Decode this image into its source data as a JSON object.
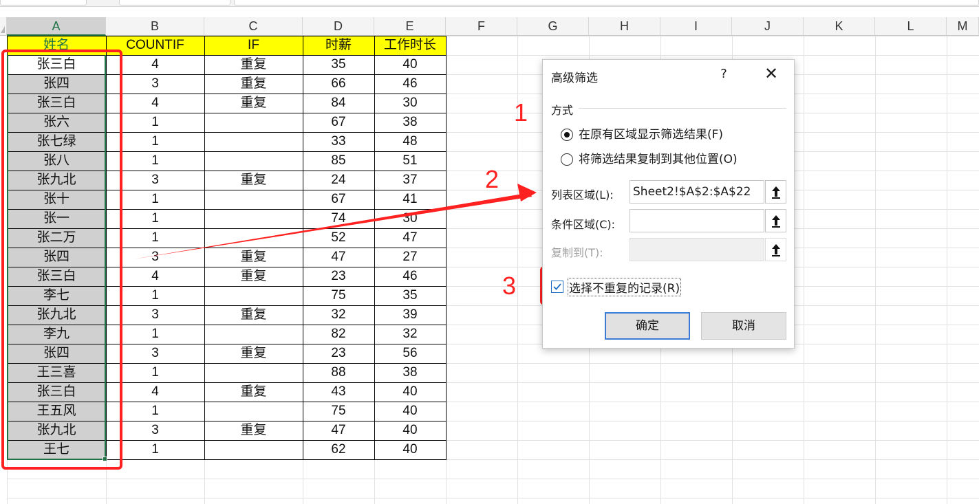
{
  "columns": [
    "A",
    "B",
    "C",
    "D",
    "E",
    "F",
    "G",
    "H",
    "I",
    "J",
    "K",
    "L",
    "M"
  ],
  "header_row": [
    "姓名",
    "COUNTIF",
    "IF",
    "时薪",
    "工作时长"
  ],
  "rows": [
    [
      "张三白",
      "4",
      "重复",
      "35",
      "40"
    ],
    [
      "张四",
      "3",
      "重复",
      "66",
      "46"
    ],
    [
      "张三白",
      "4",
      "重复",
      "84",
      "30"
    ],
    [
      "张六",
      "1",
      "",
      "67",
      "38"
    ],
    [
      "张七绿",
      "1",
      "",
      "33",
      "48"
    ],
    [
      "张八",
      "1",
      "",
      "85",
      "51"
    ],
    [
      "张九北",
      "3",
      "重复",
      "24",
      "37"
    ],
    [
      "张十",
      "1",
      "",
      "67",
      "41"
    ],
    [
      "张一",
      "1",
      "",
      "74",
      "30"
    ],
    [
      "张二万",
      "1",
      "",
      "52",
      "47"
    ],
    [
      "张四",
      "3",
      "重复",
      "47",
      "27"
    ],
    [
      "张三白",
      "4",
      "重复",
      "23",
      "46"
    ],
    [
      "李七",
      "1",
      "",
      "75",
      "35"
    ],
    [
      "张九北",
      "3",
      "重复",
      "32",
      "39"
    ],
    [
      "李九",
      "1",
      "",
      "82",
      "32"
    ],
    [
      "张四",
      "3",
      "重复",
      "23",
      "56"
    ],
    [
      "王三喜",
      "1",
      "",
      "88",
      "38"
    ],
    [
      "张三白",
      "4",
      "重复",
      "43",
      "40"
    ],
    [
      "王五风",
      "1",
      "",
      "75",
      "40"
    ],
    [
      "张九北",
      "3",
      "重复",
      "47",
      "40"
    ],
    [
      "王七",
      "1",
      "",
      "62",
      "40"
    ]
  ],
  "annotations": {
    "n1": "1",
    "n2": "2",
    "n3": "3"
  },
  "dialog": {
    "title": "高级筛选",
    "help": "?",
    "close": "✕",
    "mode_label": "方式",
    "radio_inplace": "在原有区域显示筛选结果(F)",
    "radio_copy": "将筛选结果复制到其他位置(O)",
    "list_range_label": "列表区域(L):",
    "list_range_value": "Sheet2!$A$2:$A$22",
    "criteria_label": "条件区域(C):",
    "criteria_value": "",
    "copy_to_label": "复制到(T):",
    "unique_label": "选择不重复的记录(R)",
    "ok": "确定",
    "cancel": "取消"
  },
  "colors": {
    "header_yellow": "#ffff00",
    "selected_gray": "#d0d0d0",
    "selection_green": "#217346",
    "annotation_red": "#ff2020"
  }
}
